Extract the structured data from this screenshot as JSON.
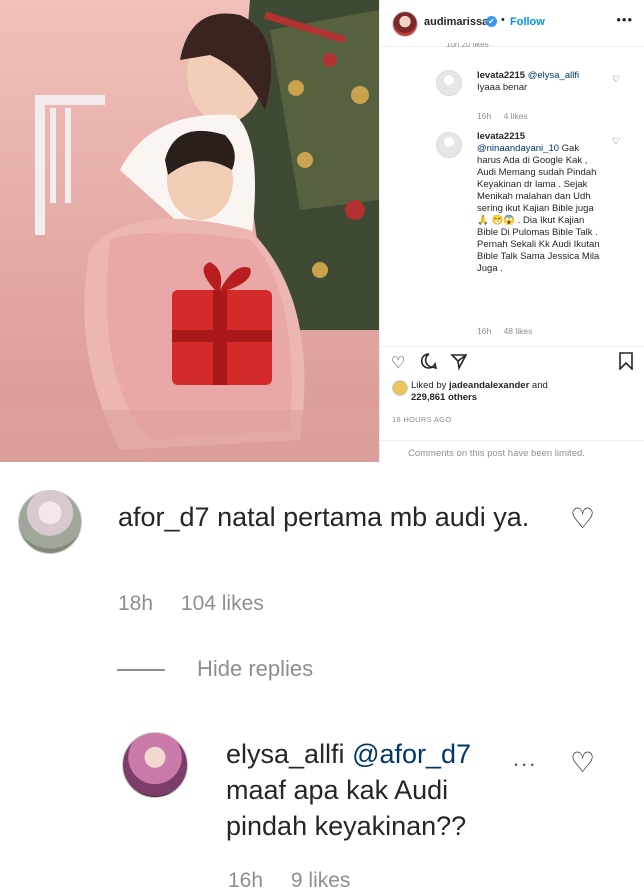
{
  "post_header": {
    "username": "audimarissa",
    "verified_mark": "✔",
    "separator": "•",
    "follow_label": "Follow",
    "more_icon": "ellipsis-icon"
  },
  "panel_comments": [
    {
      "cut_text": "10h   20 likes",
      "user": "levata2215",
      "mention": "@elysa_allfi",
      "text": "Iyaaa benar",
      "time": "16h",
      "likes": "4 likes"
    },
    {
      "user": "levata2215",
      "mention": "@ninaandayani_10",
      "text": "Gak harus Ada di Google Kak , Audi Memang sudah Pindah Keyakinan dr lama . Sejak Menikah malahan dan Udh sering ikut Kajian Bible juga 🙏 😁😱 . Dia Ikut Kajian Bible Di Pulomas Bible Talk . Pernah Sekali Kk Audi Ikutan Bible Talk Sama Jessica Mila Juga .",
      "time": "16h",
      "likes": "48 likes"
    }
  ],
  "post_actions": {
    "liked_by_prefix": "Liked by ",
    "liked_by_user": "jadeandalexander",
    "liked_by_and": " and",
    "liked_by_count": "229,861 others",
    "timestamp": "18 HOURS AGO",
    "limited_notice": "Comments on this post have been limited."
  },
  "mobile_comments": {
    "comment1": {
      "user": "afor_d7",
      "text": "natal pertama mb audi ya.",
      "time": "18h",
      "likes": "104 likes"
    },
    "hide_replies_label": "Hide replies",
    "reply1": {
      "user": "elysa_allfi",
      "mention": "@afor_d7",
      "text": "maaf apa kak Audi pindah keyakinan??",
      "time": "16h",
      "likes": "9 likes",
      "more": "..."
    }
  },
  "colors": {
    "link": "#0095f6",
    "mention": "#00376b",
    "muted": "#8e8e8e",
    "text": "#262626"
  }
}
